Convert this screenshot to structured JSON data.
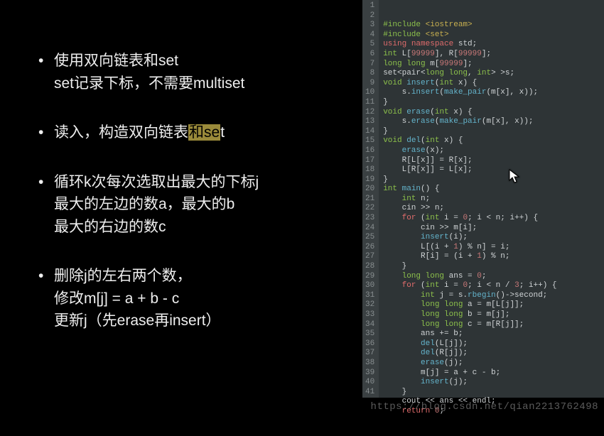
{
  "slide": {
    "bullets": [
      {
        "lines": [
          {
            "pre": "使用双向链表和set",
            "hl": "",
            "post": ""
          },
          {
            "pre": "set记录下标，不需要multiset",
            "hl": "",
            "post": ""
          }
        ]
      },
      {
        "lines": [
          {
            "pre": "读入，构造双向链表",
            "hl": "和se",
            "post": "t"
          }
        ]
      },
      {
        "lines": [
          {
            "pre": "循环k次每次选取出最大的下标j",
            "hl": "",
            "post": ""
          },
          {
            "pre": "最大的左边的数a，最大的b",
            "hl": "",
            "post": ""
          },
          {
            "pre": "最大的右边的数c",
            "hl": "",
            "post": ""
          }
        ]
      },
      {
        "lines": [
          {
            "pre": "删除j的左右两个数，",
            "hl": "",
            "post": ""
          },
          {
            "pre": "修改m[j] = a + b - c",
            "hl": "",
            "post": ""
          },
          {
            "pre": "更新j（先erase再insert）",
            "hl": "",
            "post": ""
          }
        ]
      }
    ]
  },
  "code": {
    "lines": [
      [
        {
          "c": "tok-pp",
          "t": "#include"
        },
        {
          "c": "tok-id",
          "t": " "
        },
        {
          "c": "tok-str",
          "t": "<iostream>"
        }
      ],
      [
        {
          "c": "tok-pp",
          "t": "#include"
        },
        {
          "c": "tok-id",
          "t": " "
        },
        {
          "c": "tok-str",
          "t": "<set>"
        }
      ],
      [
        {
          "c": "tok-kw",
          "t": "using"
        },
        {
          "c": "tok-id",
          "t": " "
        },
        {
          "c": "tok-kw",
          "t": "namespace"
        },
        {
          "c": "tok-id",
          "t": " std;"
        }
      ],
      [
        {
          "c": "tok-type",
          "t": "int"
        },
        {
          "c": "tok-id",
          "t": " L["
        },
        {
          "c": "tok-num",
          "t": "99999"
        },
        {
          "c": "tok-id",
          "t": "], R["
        },
        {
          "c": "tok-num",
          "t": "99999"
        },
        {
          "c": "tok-id",
          "t": "];"
        }
      ],
      [
        {
          "c": "tok-type",
          "t": "long long"
        },
        {
          "c": "tok-id",
          "t": " m["
        },
        {
          "c": "tok-num",
          "t": "99999"
        },
        {
          "c": "tok-id",
          "t": "];"
        }
      ],
      [
        {
          "c": "tok-id",
          "t": "set<pair<"
        },
        {
          "c": "tok-type",
          "t": "long long"
        },
        {
          "c": "tok-id",
          "t": ", "
        },
        {
          "c": "tok-type",
          "t": "int"
        },
        {
          "c": "tok-id",
          "t": "> >s;"
        }
      ],
      [
        {
          "c": "tok-type",
          "t": "void"
        },
        {
          "c": "tok-id",
          "t": " "
        },
        {
          "c": "tok-fn",
          "t": "insert"
        },
        {
          "c": "tok-id",
          "t": "("
        },
        {
          "c": "tok-type",
          "t": "int"
        },
        {
          "c": "tok-id",
          "t": " x) {"
        }
      ],
      [
        {
          "c": "tok-id",
          "t": "    s."
        },
        {
          "c": "tok-fn",
          "t": "insert"
        },
        {
          "c": "tok-id",
          "t": "("
        },
        {
          "c": "tok-fn",
          "t": "make_pair"
        },
        {
          "c": "tok-id",
          "t": "(m[x], x));"
        }
      ],
      [
        {
          "c": "tok-id",
          "t": "}"
        }
      ],
      [
        {
          "c": "tok-type",
          "t": "void"
        },
        {
          "c": "tok-id",
          "t": " "
        },
        {
          "c": "tok-fn",
          "t": "erase"
        },
        {
          "c": "tok-id",
          "t": "("
        },
        {
          "c": "tok-type",
          "t": "int"
        },
        {
          "c": "tok-id",
          "t": " x) {"
        }
      ],
      [
        {
          "c": "tok-id",
          "t": "    s."
        },
        {
          "c": "tok-fn",
          "t": "erase"
        },
        {
          "c": "tok-id",
          "t": "("
        },
        {
          "c": "tok-fn",
          "t": "make_pair"
        },
        {
          "c": "tok-id",
          "t": "(m[x], x));"
        }
      ],
      [
        {
          "c": "tok-id",
          "t": "}"
        }
      ],
      [
        {
          "c": "tok-type",
          "t": "void"
        },
        {
          "c": "tok-id",
          "t": " "
        },
        {
          "c": "tok-fn",
          "t": "del"
        },
        {
          "c": "tok-id",
          "t": "("
        },
        {
          "c": "tok-type",
          "t": "int"
        },
        {
          "c": "tok-id",
          "t": " x) {"
        }
      ],
      [
        {
          "c": "tok-id",
          "t": "    "
        },
        {
          "c": "tok-fn",
          "t": "erase"
        },
        {
          "c": "tok-id",
          "t": "(x);"
        }
      ],
      [
        {
          "c": "tok-id",
          "t": "    R[L[x]] = R[x];"
        }
      ],
      [
        {
          "c": "tok-id",
          "t": "    L[R[x]] = L[x];"
        }
      ],
      [
        {
          "c": "tok-id",
          "t": "}"
        }
      ],
      [
        {
          "c": "tok-type",
          "t": "int"
        },
        {
          "c": "tok-id",
          "t": " "
        },
        {
          "c": "tok-fn",
          "t": "main"
        },
        {
          "c": "tok-id",
          "t": "() {"
        }
      ],
      [
        {
          "c": "tok-id",
          "t": "    "
        },
        {
          "c": "tok-type",
          "t": "int"
        },
        {
          "c": "tok-id",
          "t": " n;"
        }
      ],
      [
        {
          "c": "tok-id",
          "t": "    cin >> n;"
        }
      ],
      [
        {
          "c": "tok-id",
          "t": "    "
        },
        {
          "c": "tok-kw",
          "t": "for"
        },
        {
          "c": "tok-id",
          "t": " ("
        },
        {
          "c": "tok-type",
          "t": "int"
        },
        {
          "c": "tok-id",
          "t": " i = "
        },
        {
          "c": "tok-num",
          "t": "0"
        },
        {
          "c": "tok-id",
          "t": "; i < n; i++) {"
        }
      ],
      [
        {
          "c": "tok-id",
          "t": "        cin >> m[i];"
        }
      ],
      [
        {
          "c": "tok-id",
          "t": "        "
        },
        {
          "c": "tok-fn",
          "t": "insert"
        },
        {
          "c": "tok-id",
          "t": "(i);"
        }
      ],
      [
        {
          "c": "tok-id",
          "t": "        L[(i + "
        },
        {
          "c": "tok-num",
          "t": "1"
        },
        {
          "c": "tok-id",
          "t": ") % n] = i;"
        }
      ],
      [
        {
          "c": "tok-id",
          "t": "        R[i] = (i + "
        },
        {
          "c": "tok-num",
          "t": "1"
        },
        {
          "c": "tok-id",
          "t": ") % n;"
        }
      ],
      [
        {
          "c": "tok-id",
          "t": "    }"
        }
      ],
      [
        {
          "c": "tok-id",
          "t": "    "
        },
        {
          "c": "tok-type",
          "t": "long long"
        },
        {
          "c": "tok-id",
          "t": " ans = "
        },
        {
          "c": "tok-num",
          "t": "0"
        },
        {
          "c": "tok-id",
          "t": ";"
        }
      ],
      [
        {
          "c": "tok-id",
          "t": "    "
        },
        {
          "c": "tok-kw",
          "t": "for"
        },
        {
          "c": "tok-id",
          "t": " ("
        },
        {
          "c": "tok-type",
          "t": "int"
        },
        {
          "c": "tok-id",
          "t": " i = "
        },
        {
          "c": "tok-num",
          "t": "0"
        },
        {
          "c": "tok-id",
          "t": "; i < n / "
        },
        {
          "c": "tok-num",
          "t": "3"
        },
        {
          "c": "tok-id",
          "t": "; i++) {"
        }
      ],
      [
        {
          "c": "tok-id",
          "t": "        "
        },
        {
          "c": "tok-type",
          "t": "int"
        },
        {
          "c": "tok-id",
          "t": " j = s."
        },
        {
          "c": "tok-fn",
          "t": "rbegin"
        },
        {
          "c": "tok-id",
          "t": "()->second;"
        }
      ],
      [
        {
          "c": "tok-id",
          "t": "        "
        },
        {
          "c": "tok-type",
          "t": "long long"
        },
        {
          "c": "tok-id",
          "t": " a = m[L[j]];"
        }
      ],
      [
        {
          "c": "tok-id",
          "t": "        "
        },
        {
          "c": "tok-type",
          "t": "long long"
        },
        {
          "c": "tok-id",
          "t": " b = m[j];"
        }
      ],
      [
        {
          "c": "tok-id",
          "t": "        "
        },
        {
          "c": "tok-type",
          "t": "long long"
        },
        {
          "c": "tok-id",
          "t": " c = m[R[j]];"
        }
      ],
      [
        {
          "c": "tok-id",
          "t": "        ans += b;"
        }
      ],
      [
        {
          "c": "tok-id",
          "t": "        "
        },
        {
          "c": "tok-fn",
          "t": "del"
        },
        {
          "c": "tok-id",
          "t": "(L[j]);"
        }
      ],
      [
        {
          "c": "tok-id",
          "t": "        "
        },
        {
          "c": "tok-fn",
          "t": "del"
        },
        {
          "c": "tok-id",
          "t": "(R[j]);"
        }
      ],
      [
        {
          "c": "tok-id",
          "t": "        "
        },
        {
          "c": "tok-fn",
          "t": "erase"
        },
        {
          "c": "tok-id",
          "t": "(j);"
        }
      ],
      [
        {
          "c": "tok-id",
          "t": "        m[j] = a + c - b;"
        }
      ],
      [
        {
          "c": "tok-id",
          "t": "        "
        },
        {
          "c": "tok-fn",
          "t": "insert"
        },
        {
          "c": "tok-id",
          "t": "(j);"
        }
      ],
      [
        {
          "c": "tok-id",
          "t": "    }"
        }
      ],
      [
        {
          "c": "tok-id",
          "t": "    cout << ans << endl;"
        }
      ],
      [
        {
          "c": "tok-id",
          "t": "    "
        },
        {
          "c": "tok-kw",
          "t": "return"
        },
        {
          "c": "tok-id",
          "t": " "
        },
        {
          "c": "tok-num",
          "t": "0"
        },
        {
          "c": "tok-id",
          "t": ";"
        }
      ]
    ]
  },
  "watermark": "https://blog.csdn.net/qian2213762498"
}
